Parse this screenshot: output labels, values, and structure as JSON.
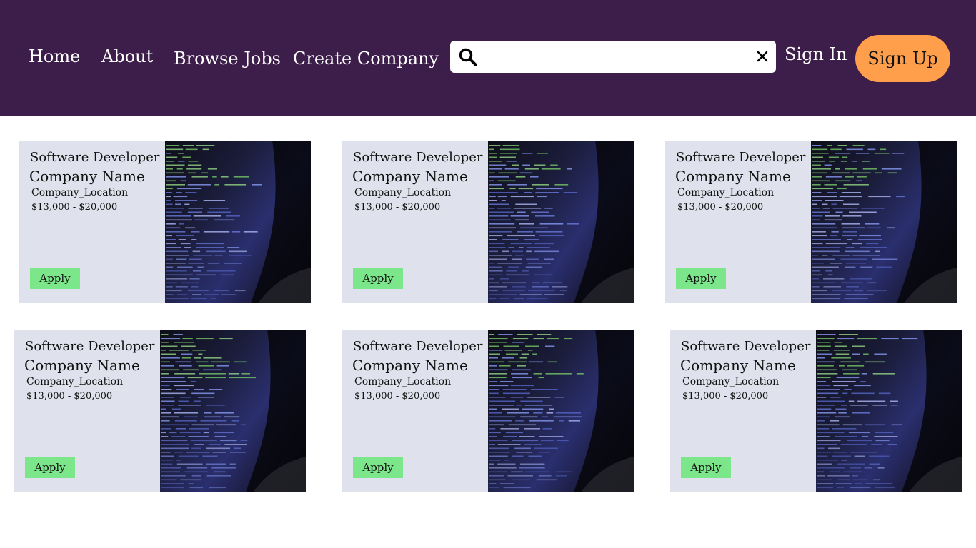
{
  "nav": {
    "home": "Home",
    "about": "About",
    "browse_jobs": "Browse Jobs",
    "create_company": "Create Company",
    "sign_in": "Sign In",
    "sign_up": "Sign Up"
  },
  "search": {
    "value": "",
    "placeholder": "",
    "search_icon": "search-icon",
    "clear_icon": "close-icon"
  },
  "colors": {
    "navbar": "#3d1e4a",
    "signup": "#ff9f4b",
    "card": "#dfe2ec",
    "apply": "#7be68a"
  },
  "jobs": [
    {
      "title": "Software Developer",
      "company": "Company Name",
      "location": "Company_Location",
      "salary": "$13,000 - $20,000",
      "apply": "Apply"
    },
    {
      "title": "Software Developer",
      "company": "Company Name",
      "location": "Company_Location",
      "salary": "$13,000 - $20,000",
      "apply": "Apply"
    },
    {
      "title": "Software Developer",
      "company": "Company Name",
      "location": "Company_Location",
      "salary": "$13,000 - $20,000",
      "apply": "Apply"
    },
    {
      "title": "Software Developer",
      "company": "Company Name",
      "location": "Company_Location",
      "salary": "$13,000 - $20,000",
      "apply": "Apply"
    },
    {
      "title": "Software Developer",
      "company": "Company Name",
      "location": "Company_Location",
      "salary": "$13,000 - $20,000",
      "apply": "Apply"
    },
    {
      "title": "Software Developer",
      "company": "Company Name",
      "location": "Company_Location",
      "salary": "$13,000 - $20,000",
      "apply": "Apply"
    }
  ]
}
